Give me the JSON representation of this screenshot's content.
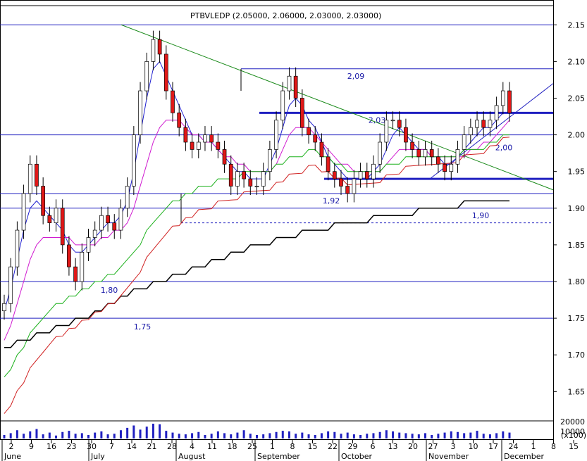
{
  "chart_data": {
    "type": "candlestick",
    "title": "PTBVLEDP (2.05000, 2.06000, 2.03000, 2.03000)",
    "ylim": [
      1.61,
      2.18
    ],
    "y_ticks": [
      "2.15",
      "2.10",
      "2.05",
      "2.00",
      "1.95",
      "1.90",
      "1.85",
      "1.80",
      "1.75",
      "1.70",
      "1.65"
    ],
    "day_ticks": [
      "2",
      "9",
      "16",
      "23",
      "30",
      "7",
      "14",
      "21",
      "28",
      "4",
      "11",
      "18",
      "25",
      "1",
      "8",
      "15",
      "22",
      "29",
      "6",
      "13",
      "20",
      "27",
      "3",
      "10",
      "17",
      "24",
      "1",
      "8",
      "15"
    ],
    "month_labels": [
      "June",
      "July",
      "August",
      "September",
      "October",
      "November",
      "December"
    ],
    "horizontal_levels": [
      {
        "value": 2.15,
        "label": ""
      },
      {
        "value": 2.09,
        "label": "2,09"
      },
      {
        "value": 2.03,
        "label": "2,03"
      },
      {
        "value": 2.0,
        "label": "2,00"
      },
      {
        "value": 1.94,
        "label": ""
      },
      {
        "value": 1.92,
        "label": "1,92"
      },
      {
        "value": 1.9,
        "label": "1,90"
      },
      {
        "value": 1.88,
        "label": ""
      },
      {
        "value": 1.8,
        "label": "1,80"
      },
      {
        "value": 1.75,
        "label": "1,75"
      }
    ],
    "volume_panel": {
      "y_ticks": [
        "20000",
        "10000"
      ],
      "scale_note": "(x100)"
    },
    "series": [
      {
        "name": "close",
        "values": [
          1.77,
          1.82,
          1.87,
          1.92,
          1.96,
          1.93,
          1.89,
          1.88,
          1.9,
          1.85,
          1.82,
          1.8,
          1.84,
          1.86,
          1.87,
          1.89,
          1.88,
          1.87,
          1.9,
          1.93,
          2.0,
          2.06,
          2.1,
          2.13,
          2.11,
          2.06,
          2.03,
          2.01,
          1.99,
          1.98,
          1.99,
          2.0,
          1.99,
          1.98,
          1.96,
          1.93,
          1.95,
          1.94,
          1.93,
          1.93,
          1.95,
          1.98,
          2.02,
          2.06,
          2.08,
          2.05,
          2.01,
          2.0,
          1.99,
          1.97,
          1.95,
          1.94,
          1.93,
          1.92,
          1.94,
          1.95,
          1.94,
          1.96,
          1.99,
          2.02,
          2.02,
          2.01,
          1.99,
          1.98,
          1.97,
          1.98,
          1.97,
          1.96,
          1.95,
          1.96,
          1.98,
          2.0,
          2.01,
          2.02,
          2.01,
          2.02,
          2.04,
          2.06,
          2.03
        ]
      },
      {
        "name": "ma_fast",
        "values": [
          1.76,
          1.79,
          1.83,
          1.87,
          1.9,
          1.91,
          1.9,
          1.89,
          1.88,
          1.87,
          1.85,
          1.84,
          1.84,
          1.85,
          1.86,
          1.87,
          1.88,
          1.88,
          1.89,
          1.91,
          1.95,
          2.0,
          2.05,
          2.09,
          2.1,
          2.08,
          2.06,
          2.04,
          2.02,
          2.0,
          2.0,
          1.99,
          1.99,
          1.98,
          1.97,
          1.96,
          1.95,
          1.95,
          1.94,
          1.94,
          1.94,
          1.96,
          1.98,
          2.01,
          2.04,
          2.05,
          2.04,
          2.02,
          2.01,
          1.99,
          1.97,
          1.96,
          1.95,
          1.94,
          1.94,
          1.94,
          1.94,
          1.95,
          1.96,
          1.98,
          2.0,
          2.01,
          2.0,
          1.99,
          1.98,
          1.98,
          1.97,
          1.97,
          1.96,
          1.96,
          1.97,
          1.98,
          1.99,
          2.0,
          2.01,
          2.01,
          2.02,
          2.03,
          2.03
        ]
      },
      {
        "name": "ma_mid",
        "values": [
          1.72,
          1.74,
          1.77,
          1.8,
          1.83,
          1.85,
          1.86,
          1.86,
          1.86,
          1.86,
          1.86,
          1.85,
          1.85,
          1.85,
          1.85,
          1.86,
          1.86,
          1.87,
          1.87,
          1.88,
          1.9,
          1.93,
          1.96,
          1.99,
          2.01,
          2.02,
          2.02,
          2.02,
          2.01,
          2.0,
          2.0,
          1.99,
          1.99,
          1.98,
          1.97,
          1.97,
          1.96,
          1.96,
          1.95,
          1.95,
          1.95,
          1.95,
          1.96,
          1.98,
          2.0,
          2.01,
          2.01,
          2.01,
          2.0,
          1.99,
          1.98,
          1.97,
          1.96,
          1.96,
          1.95,
          1.95,
          1.95,
          1.95,
          1.95,
          1.96,
          1.97,
          1.98,
          1.98,
          1.98,
          1.98,
          1.98,
          1.97,
          1.97,
          1.97,
          1.97,
          1.97,
          1.97,
          1.98,
          1.98,
          1.99,
          1.99,
          2.0,
          2.01,
          2.02
        ]
      },
      {
        "name": "ma_slow",
        "values": [
          1.67,
          1.68,
          1.7,
          1.71,
          1.73,
          1.74,
          1.75,
          1.76,
          1.77,
          1.77,
          1.78,
          1.78,
          1.79,
          1.79,
          1.8,
          1.8,
          1.81,
          1.81,
          1.82,
          1.83,
          1.84,
          1.85,
          1.87,
          1.88,
          1.89,
          1.9,
          1.91,
          1.91,
          1.92,
          1.92,
          1.93,
          1.93,
          1.93,
          1.94,
          1.94,
          1.94,
          1.94,
          1.95,
          1.95,
          1.95,
          1.95,
          1.95,
          1.96,
          1.96,
          1.97,
          1.97,
          1.97,
          1.98,
          1.98,
          1.97,
          1.97,
          1.96,
          1.96,
          1.95,
          1.95,
          1.95,
          1.95,
          1.95,
          1.95,
          1.96,
          1.96,
          1.96,
          1.97,
          1.97,
          1.97,
          1.97,
          1.97,
          1.97,
          1.97,
          1.97,
          1.97,
          1.98,
          1.98,
          1.98,
          1.98,
          1.99,
          1.99,
          2.0,
          2.0
        ]
      },
      {
        "name": "ma_long",
        "values": [
          1.71,
          1.71,
          1.72,
          1.72,
          1.72,
          1.73,
          1.73,
          1.73,
          1.74,
          1.74,
          1.74,
          1.75,
          1.75,
          1.75,
          1.76,
          1.76,
          1.77,
          1.77,
          1.78,
          1.78,
          1.79,
          1.79,
          1.79,
          1.8,
          1.8,
          1.8,
          1.81,
          1.81,
          1.81,
          1.82,
          1.82,
          1.82,
          1.83,
          1.83,
          1.83,
          1.84,
          1.84,
          1.84,
          1.85,
          1.85,
          1.85,
          1.85,
          1.86,
          1.86,
          1.86,
          1.86,
          1.87,
          1.87,
          1.87,
          1.87,
          1.87,
          1.88,
          1.88,
          1.88,
          1.88,
          1.88,
          1.88,
          1.89,
          1.89,
          1.89,
          1.89,
          1.89,
          1.89,
          1.89,
          1.9,
          1.9,
          1.9,
          1.9,
          1.9,
          1.9,
          1.9,
          1.91,
          1.91,
          1.91,
          1.91,
          1.91,
          1.91,
          1.91,
          1.91
        ]
      },
      {
        "name": "volume",
        "values": [
          6,
          9,
          14,
          8,
          12,
          16,
          7,
          10,
          5,
          11,
          13,
          8,
          9,
          6,
          10,
          12,
          7,
          8,
          14,
          18,
          22,
          15,
          20,
          25,
          24,
          13,
          10,
          8,
          7,
          9,
          11,
          6,
          8,
          12,
          9,
          7,
          10,
          14,
          8,
          6,
          7,
          9,
          11,
          13,
          12,
          8,
          10,
          7,
          6,
          9,
          12,
          11,
          8,
          10,
          7,
          6,
          8,
          9,
          11,
          14,
          12,
          10,
          9,
          8,
          7,
          9,
          6,
          8,
          10,
          12,
          11,
          9,
          10,
          13,
          8,
          7,
          9,
          12,
          10
        ]
      }
    ]
  }
}
